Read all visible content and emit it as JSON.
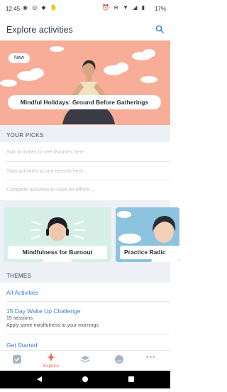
{
  "status": {
    "time": "12:45",
    "battery": "17%"
  },
  "header": {
    "title": "Explore activities"
  },
  "hero": {
    "badge": "New",
    "title": "Mindful Holidays: Ground Before Gatherings"
  },
  "your_picks": {
    "label": "YOUR PICKS",
    "rows": [
      "Star activities to see favorites here...",
      "Start activities to see recents here...",
      "Complete activities to save for offline..."
    ]
  },
  "cards": [
    {
      "label": "Mindfulness for Burnout"
    },
    {
      "label": "Practice Radic"
    }
  ],
  "themes": {
    "label": "THEMES",
    "all": "All Activities",
    "items": [
      {
        "title": "15 Day Wake Up Challenge",
        "sessions": "15 sessions",
        "desc": "Apply some mindfulness to your mornings"
      },
      {
        "title": "Get Started"
      }
    ]
  },
  "tabbar": {
    "active_label": "Explore"
  },
  "colors": {
    "accent": "#e86a4f",
    "link": "#3a7bd5",
    "hero_bg": "#f4a18c",
    "section_bg": "#edf1f6"
  }
}
